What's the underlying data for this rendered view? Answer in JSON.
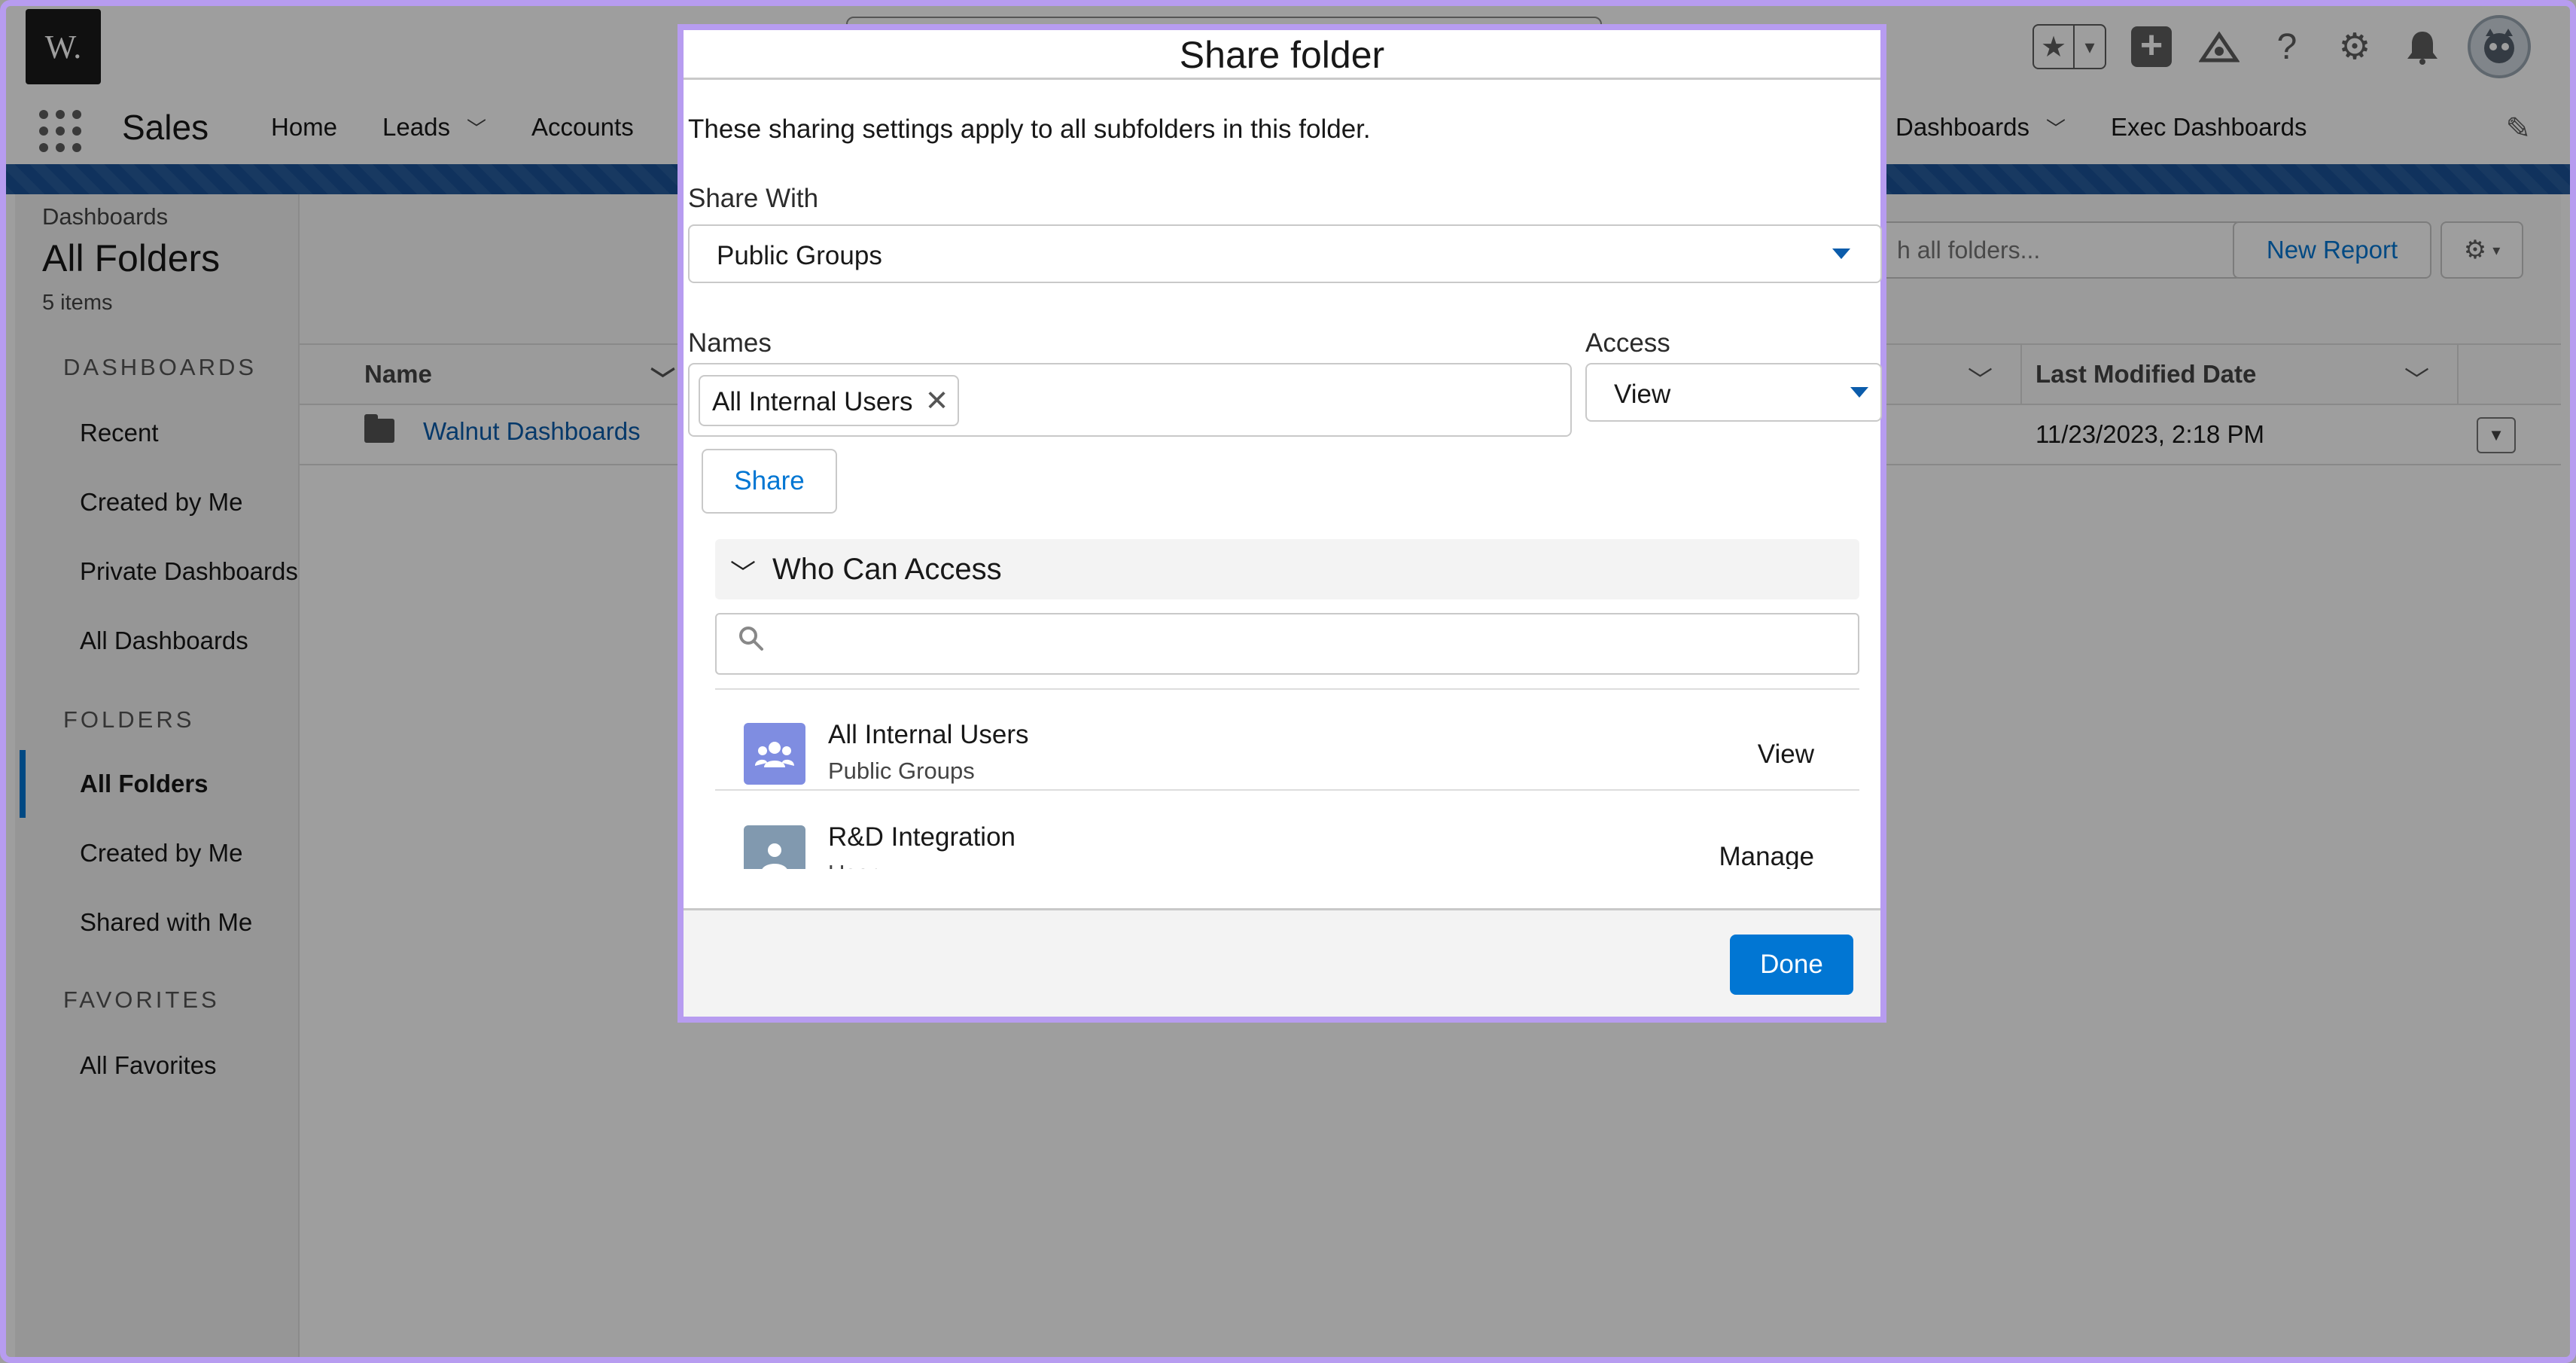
{
  "header": {
    "logo_text": "W."
  },
  "nav": {
    "app_name": "Sales",
    "items": [
      {
        "label": "Home",
        "has_menu": false
      },
      {
        "label": "Leads",
        "has_menu": true
      },
      {
        "label": "Accounts",
        "has_menu": false
      }
    ],
    "right_items": [
      {
        "label": "Dashboards",
        "has_menu": true
      },
      {
        "label": "Exec Dashboards",
        "has_menu": false
      }
    ]
  },
  "sidebar": {
    "breadcrumb": "Dashboards",
    "title": "All Folders",
    "count": "5 items",
    "sections": [
      {
        "title": "DASHBOARDS",
        "items": [
          "Recent",
          "Created by Me",
          "Private Dashboards",
          "All Dashboards"
        ]
      },
      {
        "title": "FOLDERS",
        "items": [
          "All Folders",
          "Created by Me",
          "Shared with Me"
        ]
      },
      {
        "title": "FAVORITES",
        "items": [
          "All Favorites"
        ]
      }
    ],
    "active_item": "All Folders"
  },
  "toolbar": {
    "search_placeholder": "h all folders...",
    "new_report_label": "New Report"
  },
  "table": {
    "columns": [
      "Name",
      "Last Modified Date"
    ],
    "rows": [
      {
        "name": "Walnut Dashboards",
        "last_modified": "11/23/2023, 2:18 PM"
      }
    ]
  },
  "modal": {
    "title": "Share folder",
    "description": "These sharing settings apply to all subfolders in this folder.",
    "share_with_label": "Share With",
    "share_with_value": "Public Groups",
    "names_label": "Names",
    "names_pill": "All Internal Users",
    "access_label": "Access",
    "access_value": "View",
    "share_button": "Share",
    "who_can_access_title": "Who Can Access",
    "access_list": [
      {
        "name": "All Internal Users",
        "type": "Public Groups",
        "access": "View",
        "icon": "group-icon",
        "color": "#7f8de1"
      },
      {
        "name": "R&D Integration",
        "type": "User",
        "access": "Manage",
        "icon": "user-icon",
        "color": "#8199af"
      }
    ],
    "done_button": "Done"
  },
  "colors": {
    "brand": "#0176d3",
    "link": "#0b5cab",
    "frame": "#b79cf0",
    "brand_bar": "#1b5297"
  }
}
